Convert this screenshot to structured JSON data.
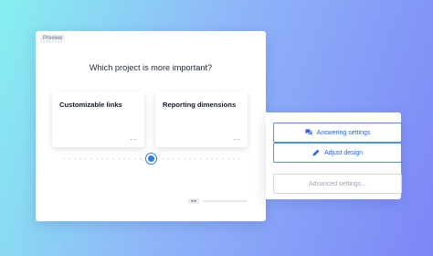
{
  "preview": {
    "tag": "Preview",
    "question": "Which project is more important?",
    "options": [
      {
        "label": "Customizable links",
        "more": "..."
      },
      {
        "label": "Reporting dimensions",
        "more": "..."
      }
    ],
    "slider": {
      "value": 0.5
    },
    "pager": {
      "arrow": "◂ ▸"
    }
  },
  "side_panel": {
    "answering_settings": "Answering settings",
    "adjust_design": "Adjust design",
    "advanced_settings": "Advanced settings..."
  },
  "icons": {
    "answering": "chat-bubbles-icon",
    "adjust": "pencil-icon"
  },
  "colors": {
    "accent": "#2f7de1",
    "button_border": "#4e8ef1",
    "button_text": "#2563eb",
    "muted_text": "#9ca3af"
  }
}
